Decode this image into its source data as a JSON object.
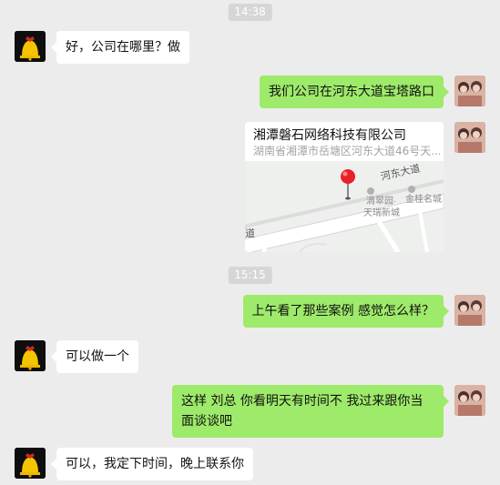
{
  "timestamps": [
    "14:38",
    "15:15"
  ],
  "messages": [
    {
      "side": "left",
      "text": "好，公司在哪里？做"
    },
    {
      "side": "right",
      "text": "我们公司在河东大道宝塔路口"
    },
    {
      "side": "right",
      "type": "location",
      "title": "湘潭磐石网络科技有限公司",
      "address": "湖南省湘潭市岳塘区河东大道46号天...",
      "map_labels": {
        "road": "河东大道",
        "road_side": "道",
        "poi1": "金桂名城",
        "poi2_line1": "滴翠园·",
        "poi2_line2": "天瑞新城"
      }
    },
    {
      "side": "right",
      "text": "上午看了那些案例 感觉怎么样？"
    },
    {
      "side": "left",
      "text": "可以做一个"
    },
    {
      "side": "right",
      "text": "这样 刘总 你看明天有时间不 我过来跟你当面谈谈吧"
    },
    {
      "side": "left",
      "text": "可以，我定下时间，晚上联系你"
    }
  ],
  "colors": {
    "background": "#ececec",
    "outgoing_bubble": "#9eea6a",
    "incoming_bubble": "#ffffff",
    "timestamp_bg": "#d6d6d6"
  },
  "icons": {
    "left_avatar": "bell-avatar-icon",
    "right_avatar": "photo-avatar-icon",
    "map_pin": "map-pin-icon"
  }
}
